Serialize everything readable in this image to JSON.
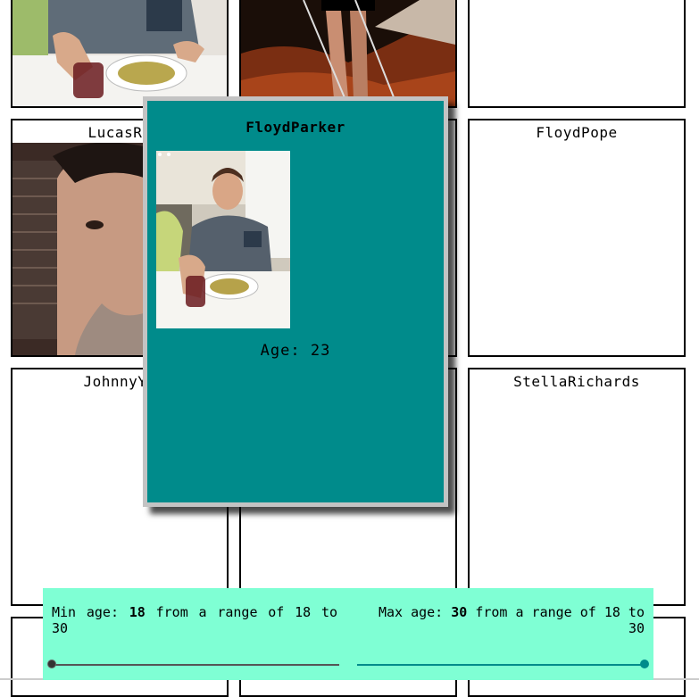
{
  "cards": [
    {
      "name": "",
      "photo": "man-at-dinner-photo"
    },
    {
      "name": "",
      "photo": "night-legs-photo"
    },
    {
      "name": ""
    },
    {
      "name": "LucasRe",
      "photo": "selfie-photo"
    },
    {
      "name": ""
    },
    {
      "name": "FloydPope"
    },
    {
      "name": "JohnnyYa"
    },
    {
      "name": ""
    },
    {
      "name": "StellaRichards"
    },
    {
      "name": ""
    },
    {
      "name": ""
    },
    {
      "name": ""
    }
  ],
  "popup": {
    "name": "FloydParker",
    "age_text": "Age: 23",
    "photo": "man-at-dinner-photo"
  },
  "filter": {
    "min_prefix": "Min age:",
    "min_value": "18",
    "min_suffix": "from a range of 18 to 30",
    "max_prefix": "Max age:",
    "max_value": "30",
    "max_suffix": "from a range of 18 to 30",
    "range_min": 18,
    "range_max": 30,
    "min_selected": 18,
    "max_selected": 30
  },
  "colors": {
    "popup_bg": "#008b8b",
    "filter_bg": "#7fffd4",
    "slider_max": "#008b8b"
  }
}
